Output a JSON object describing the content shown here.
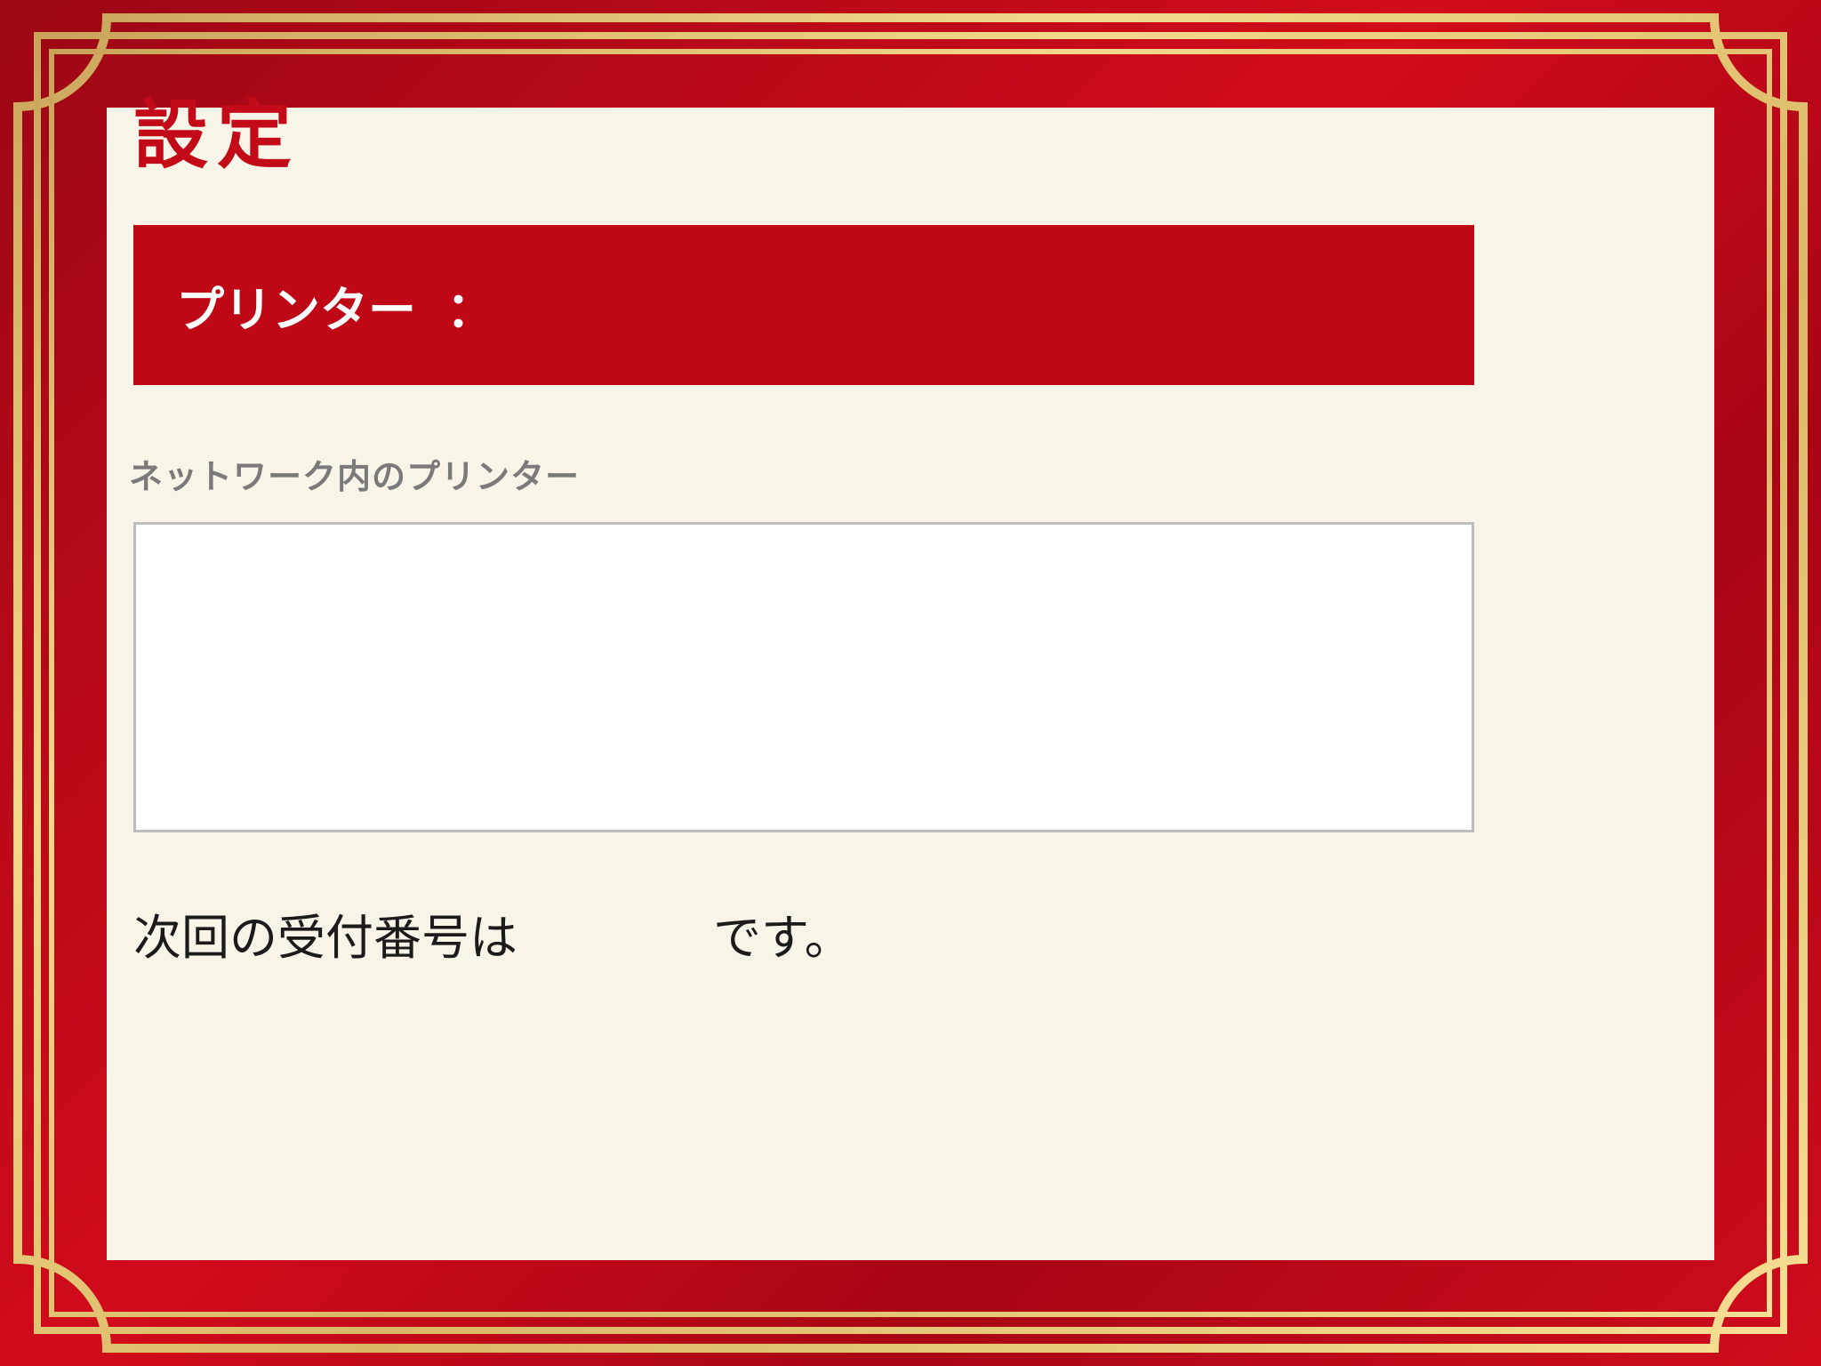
{
  "settings": {
    "title": "設定",
    "printer": {
      "label": "プリンター",
      "separator": "：",
      "value": ""
    },
    "network_printers": {
      "label": "ネットワーク内のプリンター",
      "items": []
    },
    "receipt": {
      "prefix": "次回の受付番号は",
      "number": "",
      "suffix": "です。"
    }
  },
  "colors": {
    "frame_red": "#c20a18",
    "gold": "#e8c979",
    "panel_bg": "#f8f4e8",
    "bar_red": "#bf0816"
  }
}
